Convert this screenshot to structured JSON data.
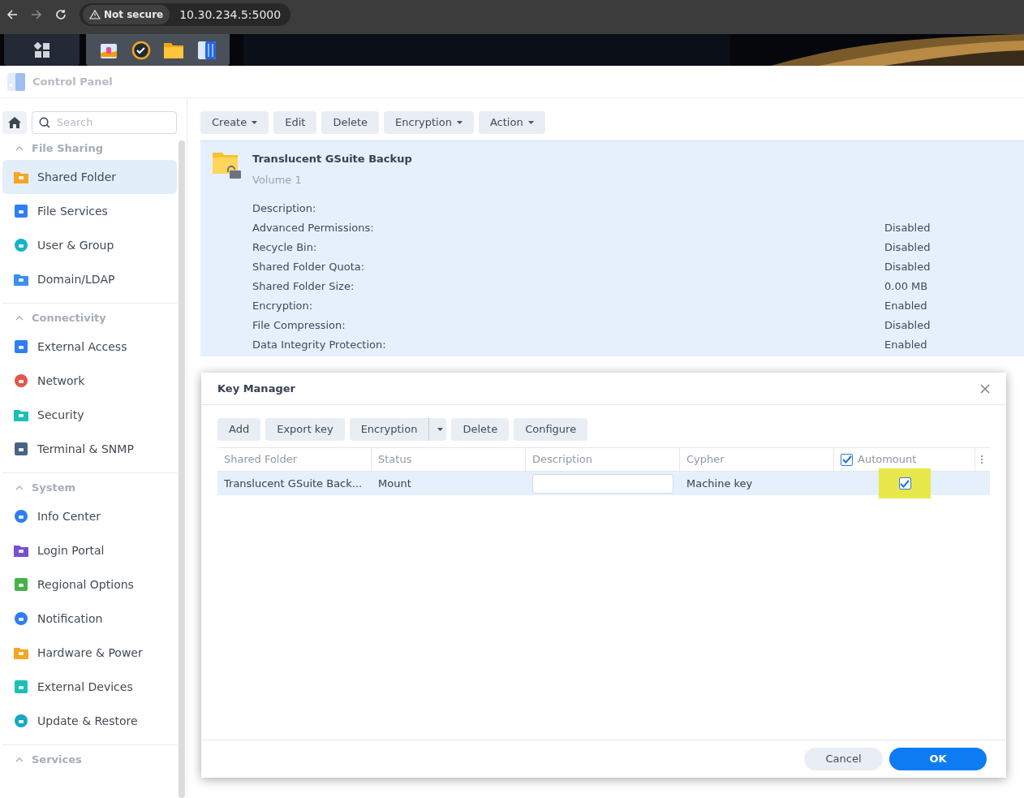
{
  "browser": {
    "security_label": "Not secure",
    "url": "10.30.234.5:5000"
  },
  "app_title": "Control Panel",
  "sidebar": {
    "search_placeholder": "Search",
    "sections": [
      {
        "title": "File Sharing",
        "expanded": true,
        "items": [
          {
            "label": "Shared Folder",
            "selected": true
          },
          {
            "label": "File Services",
            "selected": false
          },
          {
            "label": "User & Group",
            "selected": false
          },
          {
            "label": "Domain/LDAP",
            "selected": false
          }
        ]
      },
      {
        "title": "Connectivity",
        "expanded": true,
        "items": [
          {
            "label": "External Access",
            "selected": false
          },
          {
            "label": "Network",
            "selected": false
          },
          {
            "label": "Security",
            "selected": false
          },
          {
            "label": "Terminal & SNMP",
            "selected": false
          }
        ]
      },
      {
        "title": "System",
        "expanded": true,
        "items": [
          {
            "label": "Info Center",
            "selected": false
          },
          {
            "label": "Login Portal",
            "selected": false
          },
          {
            "label": "Regional Options",
            "selected": false
          },
          {
            "label": "Notification",
            "selected": false
          },
          {
            "label": "Hardware & Power",
            "selected": false
          },
          {
            "label": "External Devices",
            "selected": false
          },
          {
            "label": "Update & Restore",
            "selected": false
          }
        ]
      },
      {
        "title": "Services",
        "expanded": true
      }
    ]
  },
  "toolbar": [
    {
      "label": "Create",
      "dropdown": true
    },
    {
      "label": "Edit",
      "dropdown": false
    },
    {
      "label": "Delete",
      "dropdown": false
    },
    {
      "label": "Encryption",
      "dropdown": true
    },
    {
      "label": "Action",
      "dropdown": true
    }
  ],
  "detail": {
    "name": "Translucent GSuite Backup",
    "volume": "Volume 1",
    "properties": [
      {
        "label": "Description:"
      },
      {
        "label": "Advanced Permissions:",
        "value": "Disabled"
      },
      {
        "label": "Recycle Bin:",
        "value": "Disabled"
      },
      {
        "label": "Shared Folder Quota:",
        "value": "Disabled"
      },
      {
        "label": "Shared Folder Size:",
        "value": "0.00 MB"
      },
      {
        "label": "Encryption:",
        "value": "Enabled"
      },
      {
        "label": "File Compression:",
        "value": "Disabled"
      },
      {
        "label": "Data Integrity Protection:",
        "value": "Enabled"
      }
    ]
  },
  "dialog": {
    "title": "Key Manager",
    "toolbar": [
      {
        "label": "Add",
        "kind": "button"
      },
      {
        "label": "Export key",
        "kind": "button"
      },
      {
        "label": "Encryption",
        "kind": "split"
      },
      {
        "label": "Delete",
        "kind": "button"
      },
      {
        "label": "Configure",
        "kind": "button"
      }
    ],
    "columns": [
      {
        "label": "Shared Folder",
        "kind": "text"
      },
      {
        "label": "Status",
        "kind": "text"
      },
      {
        "label": "Description",
        "kind": "text"
      },
      {
        "label": "Cypher",
        "kind": "text"
      },
      {
        "label": "Automount",
        "kind": "checkbox",
        "checked": true
      }
    ],
    "rows": [
      {
        "shared_folder": "Translucent GSuite Back...",
        "status": "Mount",
        "cypher": "Machine key",
        "automount": true,
        "highlighted": true,
        "selected": true
      }
    ],
    "buttons": [
      {
        "label": "Cancel",
        "primary": false
      },
      {
        "label": "OK",
        "primary": true
      }
    ]
  }
}
